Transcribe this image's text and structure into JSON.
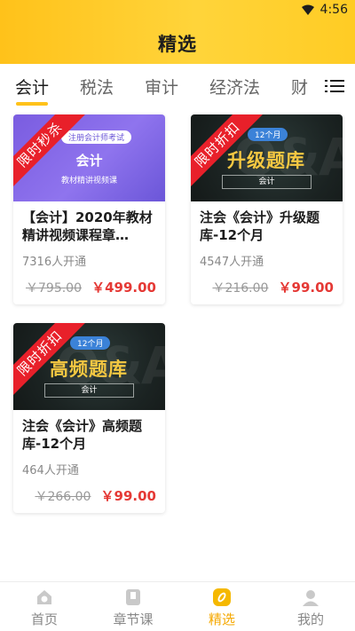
{
  "status_bar": {
    "time": "4:56"
  },
  "header": {
    "title": "精选"
  },
  "tabs": [
    "会计",
    "税法",
    "审计",
    "经济法",
    "财"
  ],
  "courses": [
    {
      "thumb": {
        "ribbon": "限时秒杀",
        "pill": "注册会计师考试",
        "title": "会计",
        "subtitle": "教材精讲视频课"
      },
      "title": "【会计】2020年教材精讲视频课程章…",
      "count": "7316人开通",
      "old_price": "￥795.00",
      "price": "￥499.00"
    },
    {
      "thumb": {
        "ribbon": "限时折扣",
        "badge": "12个月",
        "title": "升级题库",
        "subject": "会计"
      },
      "title": "注会《会计》升级题库-12个月",
      "count": "4547人开通",
      "old_price": "￥216.00",
      "price": "￥99.00"
    },
    {
      "thumb": {
        "ribbon": "限时折扣",
        "badge": "12个月",
        "title": "高频题库",
        "subject": "会计"
      },
      "title": "注会《会计》高频题库-12个月",
      "count": "464人开通",
      "old_price": "￥266.00",
      "price": "￥99.00"
    }
  ],
  "nav": [
    {
      "label": "首页",
      "icon": "home-icon"
    },
    {
      "label": "章节课",
      "icon": "book-icon"
    },
    {
      "label": "精选",
      "icon": "featured-icon"
    },
    {
      "label": "我的",
      "icon": "profile-icon"
    }
  ],
  "colors": {
    "brand": "#ffc21a",
    "price": "#e53935",
    "ribbon": "#e8202a",
    "active_nav": "#f5a800"
  }
}
